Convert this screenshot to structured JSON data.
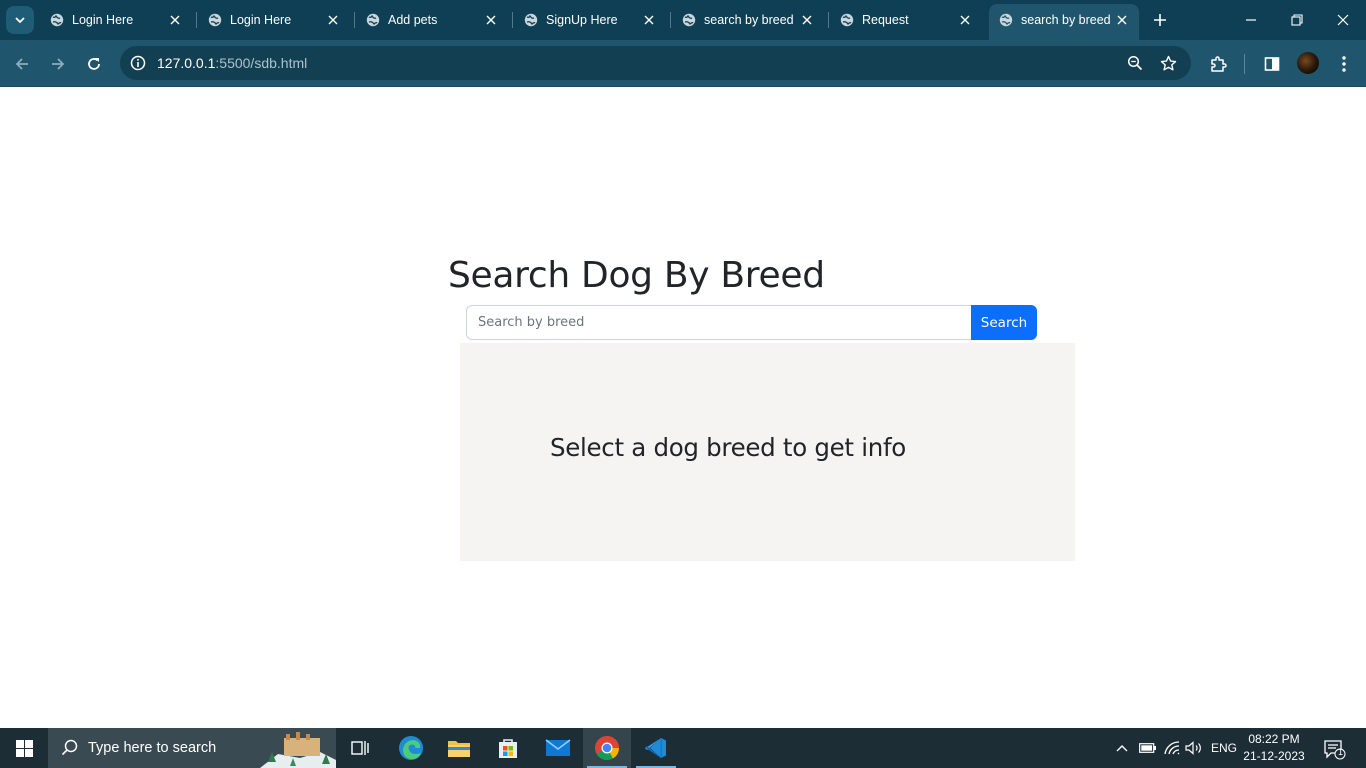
{
  "browser": {
    "tabs": [
      {
        "title": "Login Here",
        "active": false
      },
      {
        "title": "Login Here",
        "active": false
      },
      {
        "title": "Add pets",
        "active": false
      },
      {
        "title": "SignUp Here",
        "active": false
      },
      {
        "title": "search by breed",
        "active": false
      },
      {
        "title": "Request",
        "active": false
      },
      {
        "title": "search by breed",
        "active": true
      }
    ],
    "url_host": "127.0.0.1",
    "url_path": ":5500/sdb.html"
  },
  "page": {
    "heading": "Search Dog By Breed",
    "search_placeholder": "Search by breed",
    "search_value": "",
    "search_button": "Search",
    "info_text": "Select a dog breed to get info"
  },
  "taskbar": {
    "search_text": "Type here to search",
    "language": "ENG",
    "time": "08:22 PM",
    "date": "21-12-2023",
    "notification_count": "1"
  },
  "colors": {
    "tabstrip": "#0f3f54",
    "toolbar": "#20566d",
    "primary_button": "#0d6efd",
    "info_box": "#f5f4f2",
    "taskbar": "#1c2d36"
  }
}
